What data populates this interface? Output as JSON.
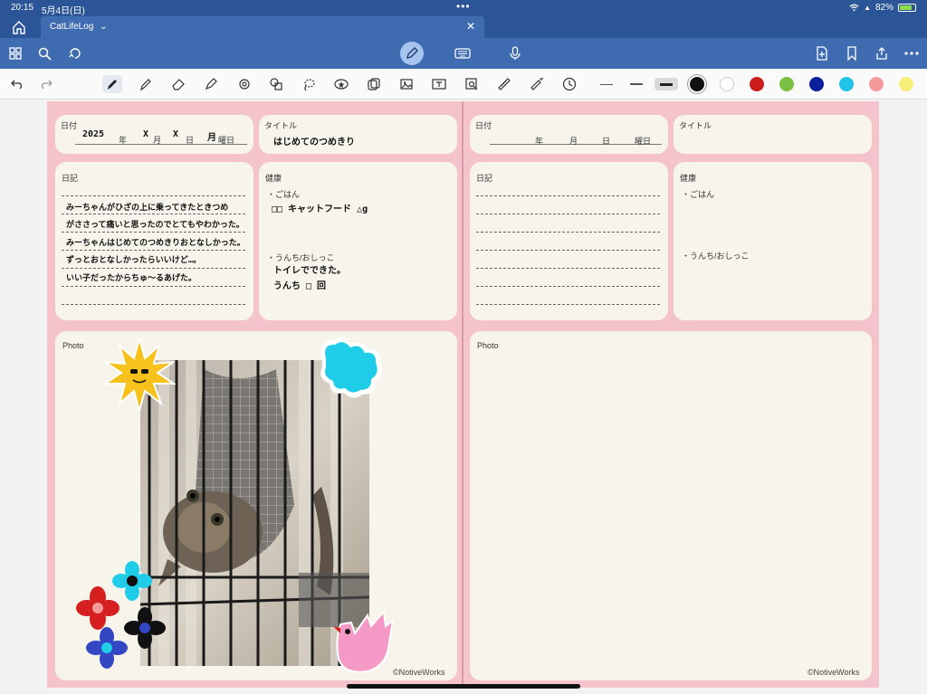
{
  "status": {
    "time": "20:15",
    "date": "5月4日(日)",
    "battery": "82%",
    "battery_level": 0.82
  },
  "tab": {
    "title": "CatLifeLog"
  },
  "toolbar": {
    "left": [
      "grid-icon",
      "search-icon",
      "lasso-sync-icon"
    ],
    "center": [
      "pen-mode-icon",
      "keyboard-icon",
      "microphone-icon"
    ],
    "right": [
      "add-page-icon",
      "bookmark-icon",
      "share-icon",
      "more-icon"
    ]
  },
  "pen_colors": [
    "#111111",
    "#ffffff",
    "#cc1d1d",
    "#7ac142",
    "#0a1f9c",
    "#20c4e8",
    "#f49a9a",
    "#f6ef7a"
  ],
  "left_page": {
    "date": {
      "label": "日付",
      "year": "2025",
      "year_unit": "年",
      "month": "X",
      "month_unit": "月",
      "day": "X",
      "day_unit": "日",
      "weekday": "月",
      "weekday_unit": "曜日"
    },
    "title": {
      "label": "タイトル",
      "value": "はじめてのつめきり"
    },
    "diary": {
      "label": "日記",
      "lines": [
        "みーちゃんがひざの上に乗ってきたときつめ",
        "がささって痛いと思ったのでとてもやわかった。",
        "みーちゃんはじめてのつめきりおとなしかった。",
        "ずっとおとなしかったらいいけど…。",
        "いい子だったからちゅ〜るあげた。"
      ]
    },
    "health": {
      "label": "健康",
      "food_label": "・ごはん",
      "food_value": "□□ キャットフード △g",
      "toilet_label": "・うんち/おしっこ",
      "toilet_line1": "トイレでできた。",
      "toilet_line2": "うんち □ 回"
    },
    "photo": {
      "label": "Photo",
      "credit": "©NotiveWorks"
    }
  },
  "right_page": {
    "date": {
      "label": "日付",
      "year_unit": "年",
      "month_unit": "月",
      "day_unit": "日",
      "weekday_unit": "曜日"
    },
    "title": {
      "label": "タイトル"
    },
    "diary": {
      "label": "日記"
    },
    "health": {
      "label": "健康",
      "food_label": "・ごはん",
      "toilet_label": "・うんち/おしっこ"
    },
    "photo": {
      "label": "Photo",
      "credit": "©NotiveWorks"
    }
  }
}
